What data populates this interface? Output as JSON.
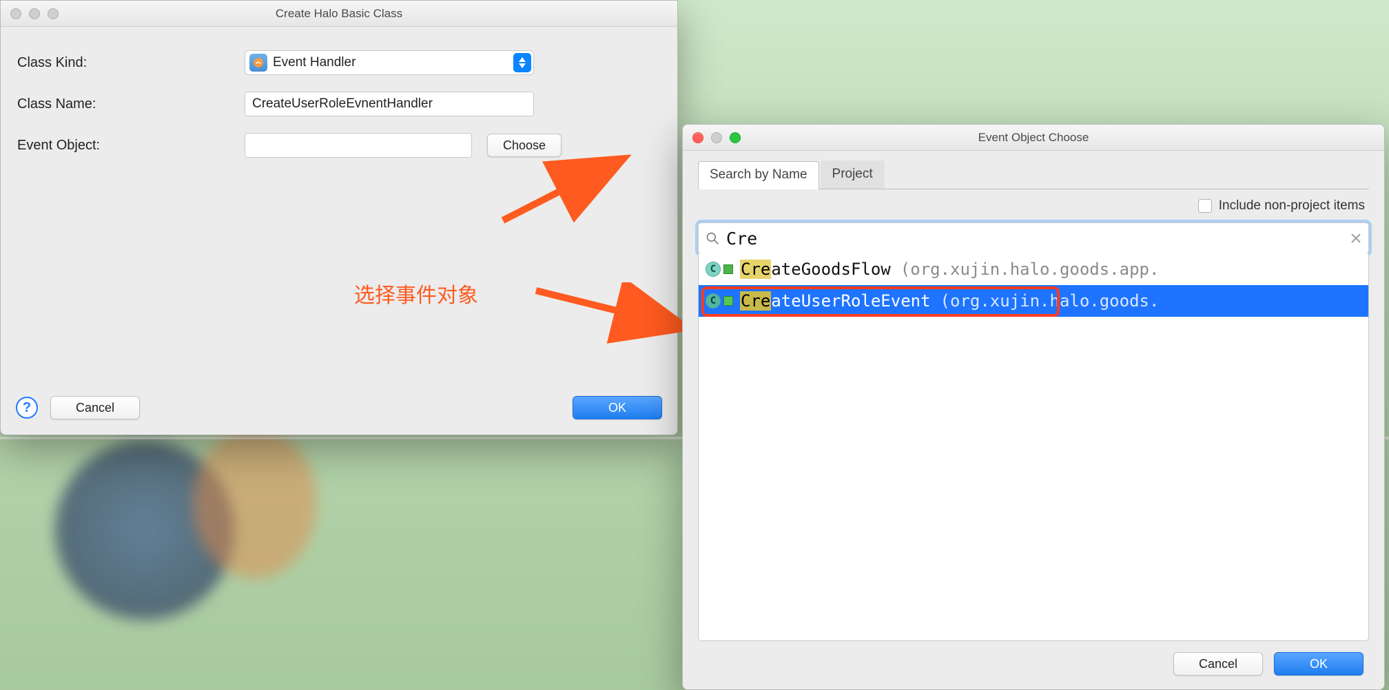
{
  "win1": {
    "title": "Create Halo Basic Class",
    "labels": {
      "kind": "Class Kind:",
      "name": "Class  Name:",
      "obj": "Event Object:"
    },
    "kind_value": "Event Handler",
    "name_value": "CreateUserRoleEvnentHandler",
    "obj_value": "",
    "choose": "Choose",
    "cancel": "Cancel",
    "ok": "OK",
    "help": "?"
  },
  "annotation": "选择事件对象",
  "win2": {
    "title": "Event Object Choose",
    "tabs": {
      "search": "Search by Name",
      "project": "Project"
    },
    "include": "Include non-project items",
    "query": "Cre",
    "results": [
      {
        "name": "CreateGoodsFlow",
        "pkg": "(org.xujin.halo.goods.app.",
        "selected": false
      },
      {
        "name": "CreateUserRoleEvent",
        "pkg": "(org.xujin.halo.goods.",
        "selected": true
      }
    ],
    "cancel": "Cancel",
    "ok": "OK"
  }
}
